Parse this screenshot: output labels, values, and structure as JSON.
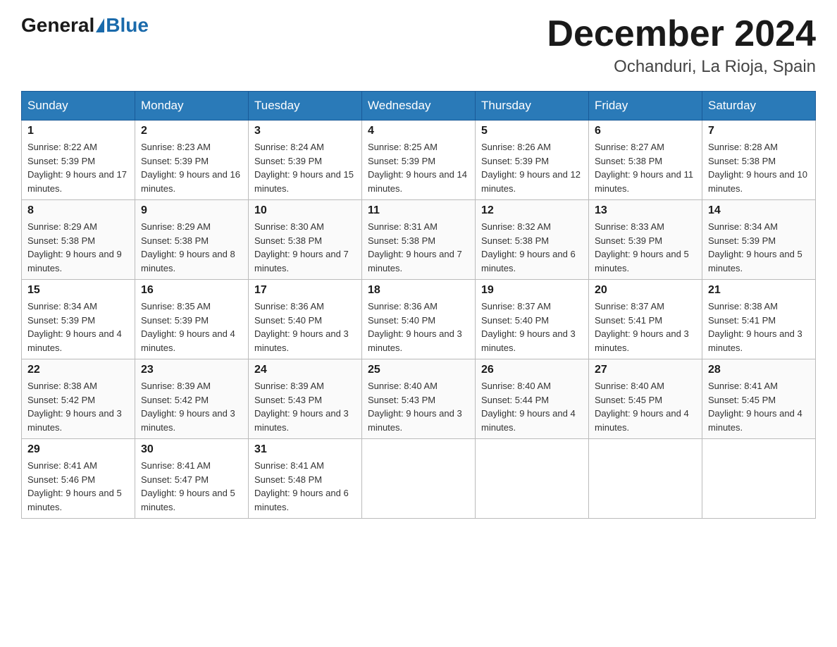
{
  "header": {
    "logo": {
      "general": "General",
      "blue": "Blue"
    },
    "title": "December 2024",
    "location": "Ochanduri, La Rioja, Spain"
  },
  "weekdays": [
    "Sunday",
    "Monday",
    "Tuesday",
    "Wednesday",
    "Thursday",
    "Friday",
    "Saturday"
  ],
  "weeks": [
    [
      {
        "day": "1",
        "sunrise": "8:22 AM",
        "sunset": "5:39 PM",
        "daylight": "9 hours and 17 minutes."
      },
      {
        "day": "2",
        "sunrise": "8:23 AM",
        "sunset": "5:39 PM",
        "daylight": "9 hours and 16 minutes."
      },
      {
        "day": "3",
        "sunrise": "8:24 AM",
        "sunset": "5:39 PM",
        "daylight": "9 hours and 15 minutes."
      },
      {
        "day": "4",
        "sunrise": "8:25 AM",
        "sunset": "5:39 PM",
        "daylight": "9 hours and 14 minutes."
      },
      {
        "day": "5",
        "sunrise": "8:26 AM",
        "sunset": "5:39 PM",
        "daylight": "9 hours and 12 minutes."
      },
      {
        "day": "6",
        "sunrise": "8:27 AM",
        "sunset": "5:38 PM",
        "daylight": "9 hours and 11 minutes."
      },
      {
        "day": "7",
        "sunrise": "8:28 AM",
        "sunset": "5:38 PM",
        "daylight": "9 hours and 10 minutes."
      }
    ],
    [
      {
        "day": "8",
        "sunrise": "8:29 AM",
        "sunset": "5:38 PM",
        "daylight": "9 hours and 9 minutes."
      },
      {
        "day": "9",
        "sunrise": "8:29 AM",
        "sunset": "5:38 PM",
        "daylight": "9 hours and 8 minutes."
      },
      {
        "day": "10",
        "sunrise": "8:30 AM",
        "sunset": "5:38 PM",
        "daylight": "9 hours and 7 minutes."
      },
      {
        "day": "11",
        "sunrise": "8:31 AM",
        "sunset": "5:38 PM",
        "daylight": "9 hours and 7 minutes."
      },
      {
        "day": "12",
        "sunrise": "8:32 AM",
        "sunset": "5:38 PM",
        "daylight": "9 hours and 6 minutes."
      },
      {
        "day": "13",
        "sunrise": "8:33 AM",
        "sunset": "5:39 PM",
        "daylight": "9 hours and 5 minutes."
      },
      {
        "day": "14",
        "sunrise": "8:34 AM",
        "sunset": "5:39 PM",
        "daylight": "9 hours and 5 minutes."
      }
    ],
    [
      {
        "day": "15",
        "sunrise": "8:34 AM",
        "sunset": "5:39 PM",
        "daylight": "9 hours and 4 minutes."
      },
      {
        "day": "16",
        "sunrise": "8:35 AM",
        "sunset": "5:39 PM",
        "daylight": "9 hours and 4 minutes."
      },
      {
        "day": "17",
        "sunrise": "8:36 AM",
        "sunset": "5:40 PM",
        "daylight": "9 hours and 3 minutes."
      },
      {
        "day": "18",
        "sunrise": "8:36 AM",
        "sunset": "5:40 PM",
        "daylight": "9 hours and 3 minutes."
      },
      {
        "day": "19",
        "sunrise": "8:37 AM",
        "sunset": "5:40 PM",
        "daylight": "9 hours and 3 minutes."
      },
      {
        "day": "20",
        "sunrise": "8:37 AM",
        "sunset": "5:41 PM",
        "daylight": "9 hours and 3 minutes."
      },
      {
        "day": "21",
        "sunrise": "8:38 AM",
        "sunset": "5:41 PM",
        "daylight": "9 hours and 3 minutes."
      }
    ],
    [
      {
        "day": "22",
        "sunrise": "8:38 AM",
        "sunset": "5:42 PM",
        "daylight": "9 hours and 3 minutes."
      },
      {
        "day": "23",
        "sunrise": "8:39 AM",
        "sunset": "5:42 PM",
        "daylight": "9 hours and 3 minutes."
      },
      {
        "day": "24",
        "sunrise": "8:39 AM",
        "sunset": "5:43 PM",
        "daylight": "9 hours and 3 minutes."
      },
      {
        "day": "25",
        "sunrise": "8:40 AM",
        "sunset": "5:43 PM",
        "daylight": "9 hours and 3 minutes."
      },
      {
        "day": "26",
        "sunrise": "8:40 AM",
        "sunset": "5:44 PM",
        "daylight": "9 hours and 4 minutes."
      },
      {
        "day": "27",
        "sunrise": "8:40 AM",
        "sunset": "5:45 PM",
        "daylight": "9 hours and 4 minutes."
      },
      {
        "day": "28",
        "sunrise": "8:41 AM",
        "sunset": "5:45 PM",
        "daylight": "9 hours and 4 minutes."
      }
    ],
    [
      {
        "day": "29",
        "sunrise": "8:41 AM",
        "sunset": "5:46 PM",
        "daylight": "9 hours and 5 minutes."
      },
      {
        "day": "30",
        "sunrise": "8:41 AM",
        "sunset": "5:47 PM",
        "daylight": "9 hours and 5 minutes."
      },
      {
        "day": "31",
        "sunrise": "8:41 AM",
        "sunset": "5:48 PM",
        "daylight": "9 hours and 6 minutes."
      },
      null,
      null,
      null,
      null
    ]
  ]
}
